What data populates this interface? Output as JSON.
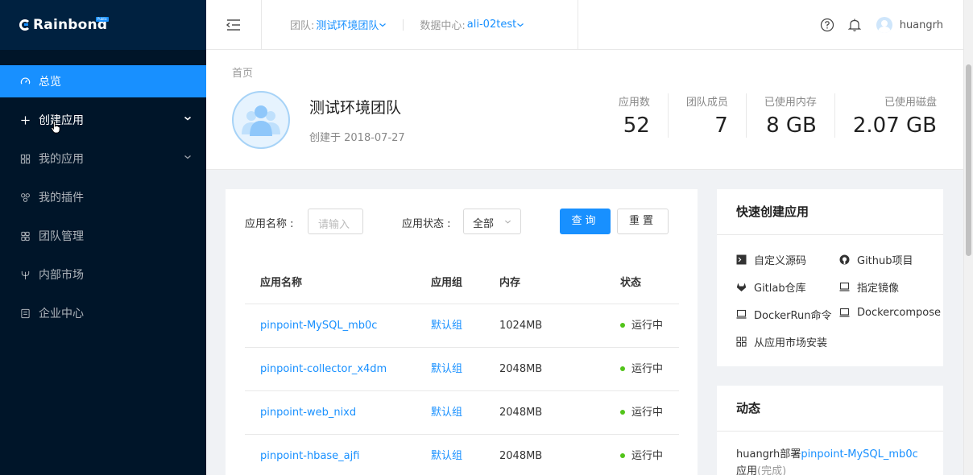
{
  "brand": {
    "name": "Rainbond",
    "badge": "Public"
  },
  "sidebar": {
    "items": [
      {
        "label": "总览",
        "icon": "dashboard-icon",
        "active": true
      },
      {
        "label": "创建应用",
        "icon": "plus-icon",
        "has_arrow": true
      },
      {
        "label": "我的应用",
        "icon": "appstore-icon",
        "has_arrow": true
      },
      {
        "label": "我的插件",
        "icon": "plugin-icon"
      },
      {
        "label": "团队管理",
        "icon": "team-icon"
      },
      {
        "label": "内部市场",
        "icon": "fork-icon"
      },
      {
        "label": "企业中心",
        "icon": "enterprise-icon"
      }
    ]
  },
  "header": {
    "team_label": "团队:",
    "team_value": "测试环境团队",
    "dc_label": "数据中心:",
    "dc_value": "ali-02test",
    "username": "huangrh"
  },
  "page": {
    "breadcrumb": "首页",
    "team_name": "测试环境团队",
    "created": "创建于 2018-07-27",
    "stats": [
      {
        "label": "应用数",
        "value": "52"
      },
      {
        "label": "团队成员",
        "value": "7"
      },
      {
        "label": "已使用内存",
        "value": "8 GB"
      },
      {
        "label": "已使用磁盘",
        "value": "2.07 GB"
      }
    ]
  },
  "filter": {
    "name_label": "应用名称 :",
    "name_placeholder": "请输入",
    "status_label": "应用状态 :",
    "status_value": "全部",
    "query_label": "查询",
    "reset_label": "重置"
  },
  "table": {
    "columns": [
      "应用名称",
      "应用组",
      "内存",
      "状态"
    ],
    "rows": [
      {
        "name": "pinpoint-MySQL_mb0c",
        "group": "默认组",
        "memory": "1024MB",
        "status": "运行中"
      },
      {
        "name": "pinpoint-collector_x4dm",
        "group": "默认组",
        "memory": "2048MB",
        "status": "运行中"
      },
      {
        "name": "pinpoint-web_nixd",
        "group": "默认组",
        "memory": "2048MB",
        "status": "运行中"
      },
      {
        "name": "pinpoint-hbase_ajfi",
        "group": "默认组",
        "memory": "2048MB",
        "status": "运行中"
      }
    ]
  },
  "quick": {
    "title": "快速创建应用",
    "items": [
      {
        "label": "自定义源码",
        "icon": "terminal-icon"
      },
      {
        "label": "Github项目",
        "icon": "github-icon"
      },
      {
        "label": "Gitlab仓库",
        "icon": "gitlab-icon"
      },
      {
        "label": "指定镜像",
        "icon": "laptop-icon"
      },
      {
        "label": "DockerRun命令",
        "icon": "laptop-icon"
      },
      {
        "label": "Dockercompose",
        "icon": "laptop-icon"
      },
      {
        "label": "从应用市场安装",
        "icon": "appstore-icon"
      }
    ]
  },
  "activity": {
    "title": "动态",
    "user": "huangrh",
    "action": "部署",
    "target": "pinpoint-MySQL_mb0c",
    "suffix": "应用",
    "status": "(完成)"
  }
}
